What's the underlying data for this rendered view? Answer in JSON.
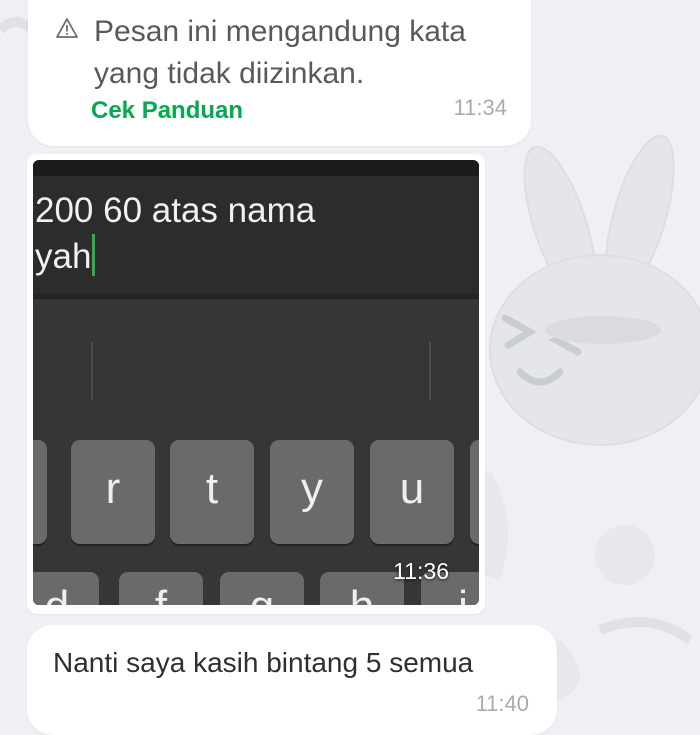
{
  "messages": [
    {
      "warning_text": "Pesan ini mengandung kata yang tidak diizinkan.",
      "warning_icon": "warning-triangle-icon",
      "guide_link": "Cek Panduan",
      "time": "11:34"
    },
    {
      "image": {
        "typed_line1": "200 60 atas nama",
        "typed_line2": "yah",
        "keys_row1": [
          "r",
          "t",
          "y",
          "u"
        ],
        "keys_row2": [
          "d",
          "f",
          "g",
          "h",
          "j"
        ]
      },
      "time": "11:36"
    },
    {
      "text": "Nanti saya kasih bintang 5 semua",
      "time": "11:40"
    }
  ],
  "colors": {
    "link_green": "#03aa4f",
    "chat_background": "#eef0f4",
    "bubble": "#ffffff"
  }
}
